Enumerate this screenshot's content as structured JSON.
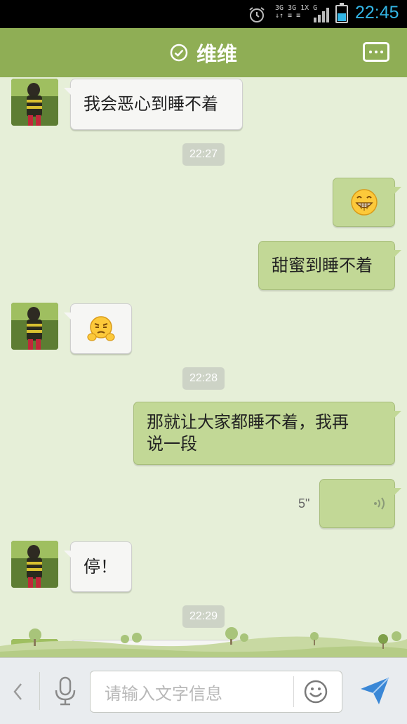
{
  "status_bar": {
    "time": "22:45",
    "network_line1": "3G 3G 1X G",
    "network_line2": "↓↑ ≡  ≡",
    "battery_level": 0.48,
    "icons": [
      "alarm-icon",
      "signal-icon",
      "battery-icon"
    ]
  },
  "header": {
    "title": "维维",
    "status_icon": "check-circle-icon",
    "menu_icon": "more-icon"
  },
  "messages": [
    {
      "side": "left",
      "type": "text",
      "text": "我会恶心到睡不着"
    },
    {
      "type": "time",
      "text": "22:27"
    },
    {
      "side": "right",
      "type": "emoji",
      "emoji": "grin-emoji"
    },
    {
      "side": "right",
      "type": "text",
      "text": "甜蜜到睡不着"
    },
    {
      "side": "left",
      "type": "emoji",
      "emoji": "annoyed-emoji"
    },
    {
      "type": "time",
      "text": "22:28"
    },
    {
      "side": "right",
      "type": "text",
      "text_line1": "那就让大家都睡不着，我再",
      "text_line2": "说一段"
    },
    {
      "side": "right",
      "type": "voice",
      "duration": "5\""
    },
    {
      "side": "left",
      "type": "text",
      "text": "停！"
    },
    {
      "type": "time",
      "text": "22:29"
    }
  ],
  "input_bar": {
    "placeholder": "请输入文字信息",
    "icons": [
      "back-icon",
      "mic-icon",
      "emoji-icon",
      "send-icon"
    ]
  },
  "colors": {
    "header": "#8fae55",
    "chat_bg": "#e6efd8",
    "bubble_right": "#c2d896",
    "bubble_left": "#f6f6f4",
    "clock": "#33b5e5"
  }
}
